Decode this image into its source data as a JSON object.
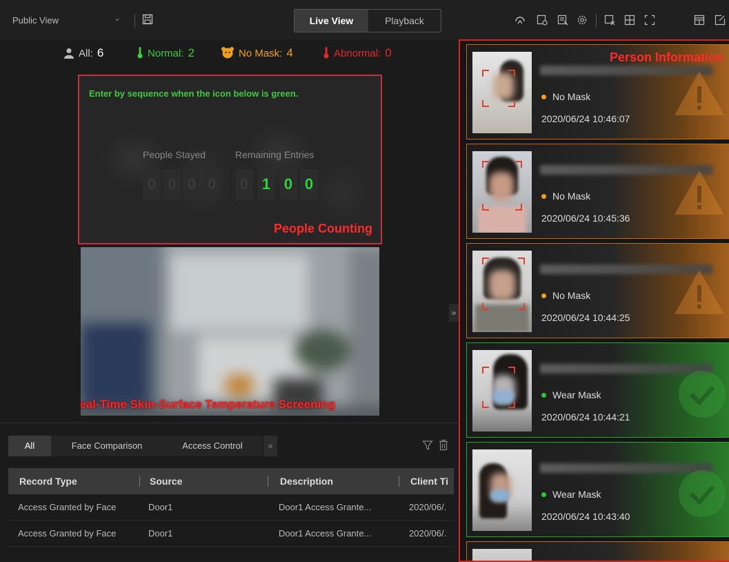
{
  "toolbar": {
    "view_name": "Public View",
    "tabs": [
      {
        "label": "Live View",
        "active": true
      },
      {
        "label": "Playback",
        "active": false
      }
    ]
  },
  "stats": {
    "all_label": "All:",
    "all_value": "6",
    "normal_label": "Normal:",
    "normal_value": "2",
    "nomask_label": "No Mask:",
    "nomask_value": "4",
    "abnormal_label": "Abnormal:",
    "abnormal_value": "0",
    "colors": {
      "all": "#cccccc",
      "normal": "#3ecb3e",
      "nomask": "#f0a020",
      "abnormal": "#e02a2a"
    }
  },
  "people_counting": {
    "hint": "Enter by sequence when the icon below is green.",
    "stayed_label": "People Stayed",
    "remaining_label": "Remaining Entries",
    "stayed_digits": [
      "0",
      "0",
      "0",
      "0"
    ],
    "remaining_digits": [
      "0",
      "1",
      "0",
      "0"
    ],
    "title": "People Counting"
  },
  "video": {
    "title": "Real-Time Skin-Surface Temperature Screening"
  },
  "bottom": {
    "tabs": [
      {
        "label": "All",
        "active": true
      },
      {
        "label": "Face Comparison",
        "active": false
      },
      {
        "label": "Access Control",
        "active": false
      }
    ],
    "more": "»",
    "table": {
      "headers": [
        "Record Type",
        "Source",
        "Description",
        "Client Ti"
      ],
      "rows": [
        [
          "Access Granted by Face",
          "Door1",
          "Door1 Access Grante...",
          "2020/06/."
        ],
        [
          "Access Granted by Face",
          "Door1",
          "Door1 Access Grante...",
          "2020/06/."
        ]
      ]
    }
  },
  "person_info": {
    "title": "Person Information",
    "cards": [
      {
        "status": "No Mask",
        "time": "2020/06/24 10:46:07",
        "type": "warn"
      },
      {
        "status": "No Mask",
        "time": "2020/06/24 10:45:36",
        "type": "warn"
      },
      {
        "status": "No Mask",
        "time": "2020/06/24 10:44:25",
        "type": "warn"
      },
      {
        "status": "Wear Mask",
        "time": "2020/06/24 10:44:21",
        "type": "ok"
      },
      {
        "status": "Wear Mask",
        "time": "2020/06/24 10:43:40",
        "type": "ok"
      }
    ],
    "colors": {
      "warn": "#f0a020",
      "ok": "#2fc43a"
    }
  },
  "icons": [
    "save-icon",
    "refresh-icon",
    "snapshot-icon",
    "record-icon",
    "gear-icon",
    "clear-icon",
    "grid-icon",
    "fullscreen-icon",
    "layout-icon",
    "popout-icon",
    "person-icon",
    "thermometer-icon",
    "mask-icon",
    "filter-icon",
    "trash-icon",
    "warning-icon",
    "check-icon"
  ]
}
